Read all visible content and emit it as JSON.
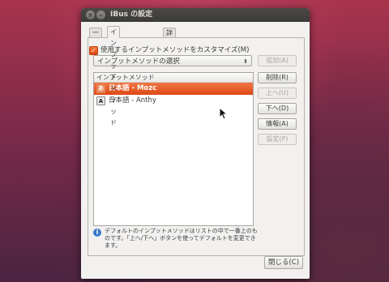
{
  "window": {
    "title": "IBus の設定"
  },
  "tabs": [
    {
      "label": "一般"
    },
    {
      "label": "インプットメソッド"
    },
    {
      "label": "詳細"
    }
  ],
  "customize": {
    "label": "使用するインプットメソッドをカスタマイズ(M)",
    "checked": true
  },
  "select": {
    "value": "インプットメソッドの選択"
  },
  "list": {
    "header": "インプットメソッド",
    "items": [
      {
        "label": "日本語 - Mozc",
        "icon": "mozc-icon",
        "selected": true
      },
      {
        "label": "日本語 - Anthy",
        "icon": "anthy-icon",
        "selected": false
      }
    ]
  },
  "buttons": {
    "add": "追加(A)",
    "remove": "削除(R)",
    "up": "上へ(U)",
    "down": "下へ(D)",
    "info": "情報(A)",
    "settings": "設定(P)",
    "close": "閉じる(C)"
  },
  "info_text": "デフォルトのインプットメソッドはリストの中で一番上のものです。「上へ/下へ」ボタンを使ってデフォルトを変更できます。",
  "colors": {
    "accent": "#dd4814",
    "titlebar": "#3c3b37"
  }
}
